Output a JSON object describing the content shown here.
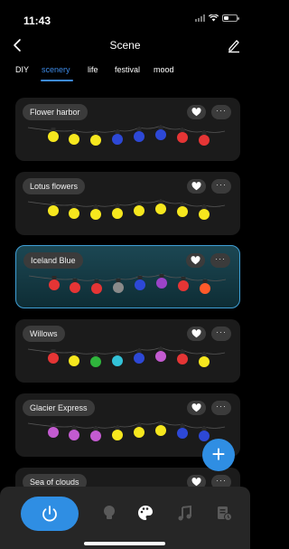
{
  "status_bar": {
    "time": "11:43"
  },
  "nav": {
    "title": "Scene"
  },
  "tabs": [
    {
      "label": "DIY",
      "active": false
    },
    {
      "label": "scenery",
      "active": true
    },
    {
      "label": "life",
      "active": false
    },
    {
      "label": "festival",
      "active": false
    },
    {
      "label": "mood",
      "active": false
    }
  ],
  "scenes": [
    {
      "name": "Flower harbor",
      "selected": false,
      "colors": [
        "#f6e71e",
        "#f6e71e",
        "#f6e71e",
        "#2d48d6",
        "#2d48d6",
        "#2d48d6",
        "#e53535",
        "#e53535"
      ]
    },
    {
      "name": "Lotus flowers",
      "selected": false,
      "colors": [
        "#f6e71e",
        "#f6e71e",
        "#f6e71e",
        "#f6e71e",
        "#f6e71e",
        "#f6e71e",
        "#f6e71e",
        "#f6e71e"
      ]
    },
    {
      "name": "Iceland Blue",
      "selected": true,
      "colors": [
        "#e53535",
        "#e53535",
        "#e53535",
        "#8a8a8a",
        "#2d48d6",
        "#9b43c7",
        "#e53535",
        "#ff5a2a"
      ]
    },
    {
      "name": "Willows",
      "selected": false,
      "colors": [
        "#e53535",
        "#f6e71e",
        "#2fb53c",
        "#33c2d8",
        "#2d48d6",
        "#c35bd0",
        "#e53535",
        "#f6e71e"
      ]
    },
    {
      "name": "Glacier Express",
      "selected": false,
      "colors": [
        "#c35bd0",
        "#c35bd0",
        "#c35bd0",
        "#f6e71e",
        "#f6e71e",
        "#f6e71e",
        "#2d48d6",
        "#2d48d6"
      ]
    },
    {
      "name": "Sea of clouds",
      "selected": false,
      "colors": []
    }
  ],
  "more_label": "···",
  "fab_label": "+",
  "accent_color": "#2f8ee3",
  "icons": [
    "back-arrow-icon",
    "edit-icon",
    "heart-icon",
    "more-icon",
    "add-icon",
    "power-icon",
    "bulb-icon",
    "palette-icon",
    "music-icon",
    "schedule-icon"
  ]
}
